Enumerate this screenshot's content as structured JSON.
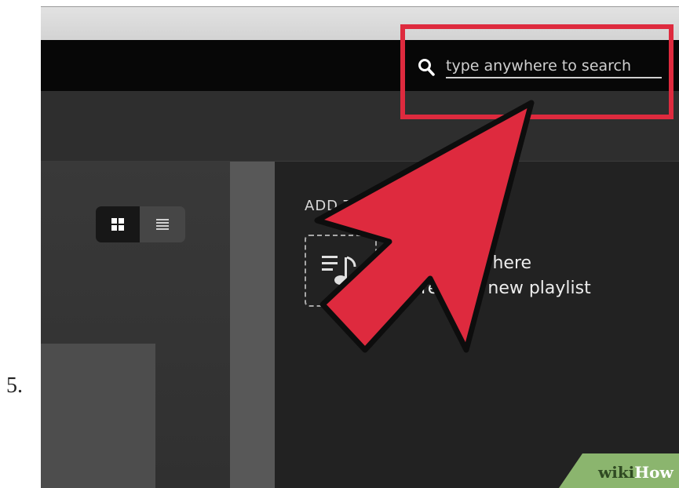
{
  "step": {
    "number": "5."
  },
  "search": {
    "placeholder": "type anywhere to search",
    "icon": "search-icon"
  },
  "view_toggle": {
    "options": [
      {
        "icon": "grid-view-icon",
        "selected": true
      },
      {
        "icon": "list-view-icon",
        "selected": false
      }
    ]
  },
  "playlists": {
    "heading": "ADD TO PLAYLISTS",
    "drop_line1": "Drag music here",
    "drop_line2": "to create a new playlist",
    "drop_icon": "playlist-add-icon"
  },
  "overlay": {
    "highlight_color": "#de2a3e",
    "arrow_color": "#de2a3e"
  },
  "watermark": {
    "brand_part1": "wiki",
    "brand_part2": "How"
  }
}
